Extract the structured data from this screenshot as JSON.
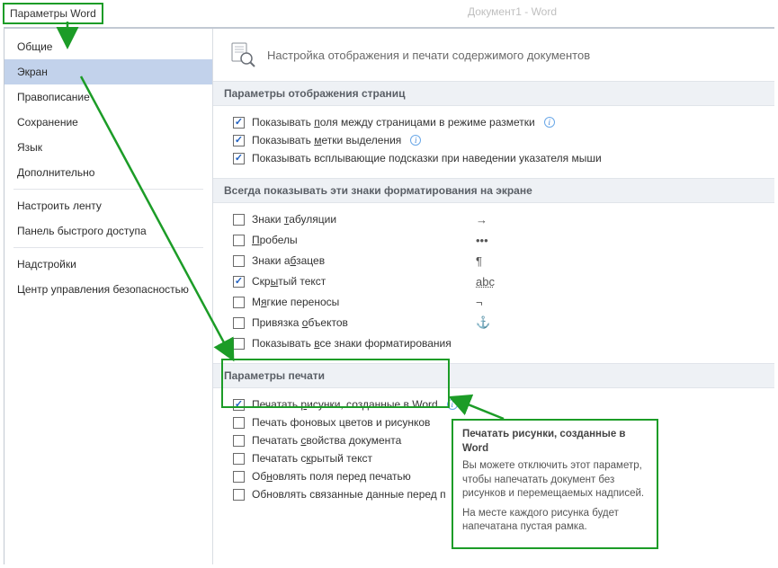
{
  "window": {
    "title": "Параметры Word",
    "doc_hint": "Документ1 - Word"
  },
  "sidebar": {
    "items": [
      {
        "label": "Общие"
      },
      {
        "label": "Экран"
      },
      {
        "label": "Правописание"
      },
      {
        "label": "Сохранение"
      },
      {
        "label": "Язык"
      },
      {
        "label": "Дополнительно"
      },
      {
        "label": "Настроить ленту"
      },
      {
        "label": "Панель быстрого доступа"
      },
      {
        "label": "Надстройки"
      },
      {
        "label": "Центр управления безопасностью"
      }
    ],
    "selected_index": 1
  },
  "header": {
    "title": "Настройка отображения и печати содержимого документов"
  },
  "sections": {
    "display": {
      "title": "Параметры отображения страниц",
      "items": [
        {
          "label": "Показывать поля между страницами в режиме разметки",
          "underline_char": "п",
          "checked": true,
          "info": true
        },
        {
          "label": "Показывать метки выделения",
          "underline_char": "м",
          "checked": true,
          "info": true
        },
        {
          "label": "Показывать всплывающие подсказки при наведении указателя мыши",
          "underline_char": "",
          "checked": true,
          "info": false
        }
      ]
    },
    "marks": {
      "title": "Всегда показывать эти знаки форматирования на экране",
      "items": [
        {
          "label": "Знаки табуляции",
          "underline_char": "т",
          "checked": false,
          "symbol": "→"
        },
        {
          "label": "Пробелы",
          "underline_char": "П",
          "checked": false,
          "symbol": "•••"
        },
        {
          "label": "Знаки абзацев",
          "underline_char": "б",
          "checked": false,
          "symbol": "¶"
        },
        {
          "label": "Скрытый текст",
          "underline_char": "ы",
          "checked": true,
          "symbol": "abc"
        },
        {
          "label": "Мягкие переносы",
          "underline_char": "я",
          "checked": false,
          "symbol": "¬"
        },
        {
          "label": "Привязка объектов",
          "underline_char": "о",
          "checked": false,
          "symbol": "⚓"
        },
        {
          "label": "Показывать все знаки форматирования",
          "underline_char": "в",
          "checked": false,
          "symbol": ""
        }
      ]
    },
    "print": {
      "title": "Параметры печати",
      "items": [
        {
          "label": "Печатать рисунки, созданные в Word",
          "underline_char": "р",
          "checked": true,
          "info": true
        },
        {
          "label": "Печать фоновых цветов и рисунков",
          "underline_char": "",
          "checked": false
        },
        {
          "label": "Печатать свойства документа",
          "underline_char": "с",
          "checked": false
        },
        {
          "label": "Печатать скрытый текст",
          "underline_char": "к",
          "checked": false
        },
        {
          "label": "Обновлять поля перед печатью",
          "underline_char": "н",
          "checked": false
        },
        {
          "label": "Обновлять связанные данные перед печатью",
          "underline_char": "",
          "checked": false
        }
      ]
    }
  },
  "tooltip": {
    "title": "Печатать рисунки, созданные в Word",
    "body1": "Вы можете отключить этот параметр, чтобы напечатать документ без рисунков и перемещаемых надписей.",
    "body2": "На месте каждого рисунка будет напечатана пустая рамка."
  }
}
